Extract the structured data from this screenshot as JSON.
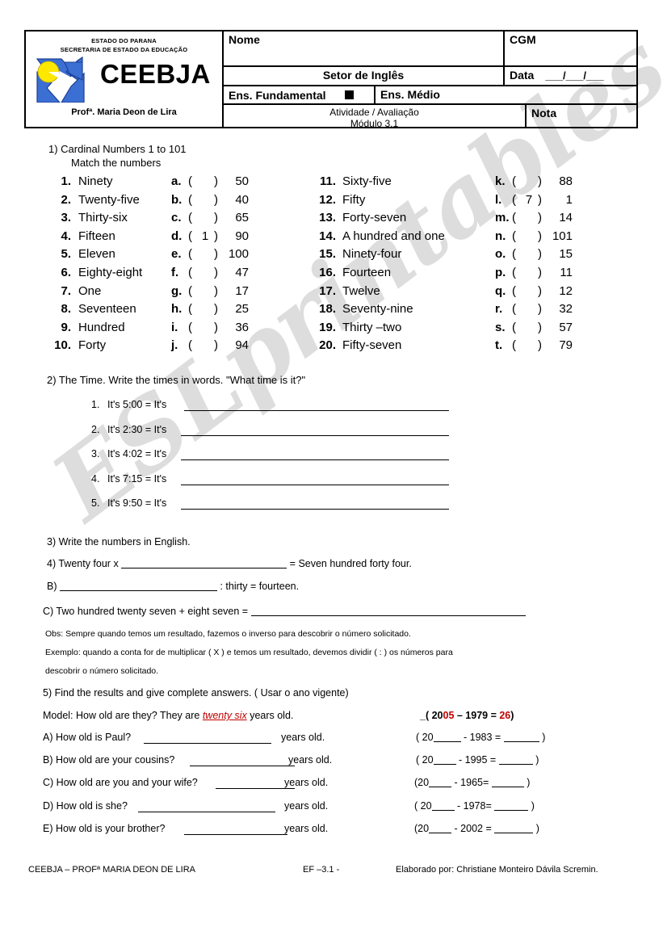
{
  "header": {
    "estado_line1": "ESTADO DO PARANA",
    "estado_line2": "SECRETARIA DE ESTADO DA EDUCAÇÃO",
    "logo_word": "CEEBJA",
    "prof_line": "Profª. Maria Deon de Lira",
    "nome_label": "Nome",
    "cgm_label": "CGM",
    "setor_label": "Setor de Inglês",
    "data_label": "Data",
    "data_blanks": "___/___/___",
    "ens_fundamental_label": "Ens. Fundamental",
    "ens_medio_label": "Ens. Médio",
    "atividade_line1": "Atividade / Avaliação",
    "atividade_line2": "Módulo 3.1",
    "nota_label": "Nota"
  },
  "watermark": {
    "text": "ESLprintables.com"
  },
  "exercise1": {
    "title": "1)  Cardinal Numbers 1 to 101",
    "subtitle": "Match the numbers",
    "left_items": [
      {
        "idx": "1.",
        "word": "Ninety",
        "letter": "a.",
        "answer": "",
        "value": "50"
      },
      {
        "idx": "2.",
        "word": "Twenty-five",
        "letter": "b.",
        "answer": "",
        "value": "40"
      },
      {
        "idx": "3.",
        "word": "Thirty-six",
        "letter": "c.",
        "answer": "",
        "value": "65"
      },
      {
        "idx": "4.",
        "word": "Fifteen",
        "letter": "d.",
        "answer": "1",
        "value": "90"
      },
      {
        "idx": "5.",
        "word": "Eleven",
        "letter": "e.",
        "answer": "",
        "value": "100"
      },
      {
        "idx": "6.",
        "word": "Eighty-eight",
        "letter": "f.",
        "answer": "",
        "value": "47"
      },
      {
        "idx": "7.",
        "word": "One",
        "letter": "g.",
        "answer": "",
        "value": "17"
      },
      {
        "idx": "8.",
        "word": "Seventeen",
        "letter": "h.",
        "answer": "",
        "value": "25"
      },
      {
        "idx": "9.",
        "word": "Hundred",
        "letter": "i.",
        "answer": "",
        "value": "36"
      },
      {
        "idx": "10.",
        "word": "Forty",
        "letter": "j.",
        "answer": "",
        "value": "94"
      }
    ],
    "right_items": [
      {
        "idx": "11.",
        "word": "Sixty-five",
        "letter": "k.",
        "answer": "",
        "value": "88"
      },
      {
        "idx": "12.",
        "word": "Fifty",
        "letter": "l.",
        "answer": "7",
        "value": "1"
      },
      {
        "idx": "13.",
        "word": "Forty-seven",
        "letter": "m.",
        "answer": "",
        "value": "14"
      },
      {
        "idx": "14.",
        "word": "A hundred and one",
        "letter": "n.",
        "answer": "",
        "value": "101"
      },
      {
        "idx": "15.",
        "word": "Ninety-four",
        "letter": "o.",
        "answer": "",
        "value": "15"
      },
      {
        "idx": "16.",
        "word": "Fourteen",
        "letter": "p.",
        "answer": "",
        "value": "11"
      },
      {
        "idx": "17.",
        "word": "Twelve",
        "letter": "q.",
        "answer": "",
        "value": "12"
      },
      {
        "idx": "18.",
        "word": "Seventy-nine",
        "letter": "r.",
        "answer": "",
        "value": "32"
      },
      {
        "idx": "19.",
        "word": "Thirty –two",
        "letter": "s.",
        "answer": "",
        "value": "57"
      },
      {
        "idx": "20.",
        "word": "Fifty-seven",
        "letter": "t.",
        "answer": "",
        "value": "79"
      }
    ]
  },
  "exercise2": {
    "title": "2)  The Time. Write the times in words. \"What time is it?\"",
    "items": [
      {
        "idx": "1.",
        "text": "It's 5:00 = It's"
      },
      {
        "idx": "2.",
        "text": "It's 2:30 = It's"
      },
      {
        "idx": "3.",
        "text": "It's 4:02 = It's"
      },
      {
        "idx": "4.",
        "text": "It's 7:15 = It's"
      },
      {
        "idx": "5.",
        "text": "It's 9:50 = It's"
      }
    ]
  },
  "exercise3": {
    "title": "3)  Write the numbers in English."
  },
  "exercise4": {
    "line_a_prefix": "4)  Twenty four x",
    "line_a_suffix": "= Seven hundred forty four.",
    "line_b_prefix": "B)",
    "line_b_suffix": ": thirty = fourteen.",
    "line_c_prefix": "C) Two hundred twenty seven + eight seven =",
    "obs": "Obs: Sempre quando temos um resultado, fazemos o inverso para descobrir o número solicitado.",
    "exemplo_line1": "Exemplo: quando a conta for de multiplicar  ( X ) e temos um resultado, devemos dividir ( : ) os números para",
    "exemplo_line2": "descobrir o número solicitado."
  },
  "exercise5": {
    "title": "5)  Find the results and give complete answers. ( Usar o ano vigente)",
    "model_prefix": "Model: How old are they? They are",
    "model_answer": "twenty six",
    "model_suffix": "years old.",
    "model_calc_open": "_( 20",
    "model_calc_red1": "05",
    "model_calc_mid": " – 1979 = ",
    "model_calc_red2": "26",
    "model_calc_close": ")",
    "items": [
      {
        "question": "A) How old is Paul?",
        "years": "years old.",
        "calc_open": "( 20",
        "calc_mid": "- 1983 =",
        "calc_close": ")"
      },
      {
        "question": "B) How old are your cousins?",
        "years": "years old.",
        "calc_open": "( 20",
        "calc_mid": "- 1995 =",
        "calc_close": ")"
      },
      {
        "question": "C) How old are you and your wife?",
        "years": "years old.",
        "calc_open": "(20",
        "calc_mid": "- 1965=",
        "calc_close": ")"
      },
      {
        "question": "D) How old is she?",
        "years": "years old.",
        "calc_open": "( 20",
        "calc_mid": "- 1978=",
        "calc_close": ")"
      },
      {
        "question": "E) How old is your brother?",
        "years": "years old.",
        "calc_open": "(20",
        "calc_mid": "- 2002 =",
        "calc_close": ")"
      }
    ]
  },
  "footer": {
    "left": "CEEBJA – PROFª MARIA DEON DE LIRA",
    "center": "EF –3.1 -",
    "right": "Elaborado por: Christiane Monteiro Dávila Scremin."
  },
  "colors": {
    "logo_blue": "#3B6FD4",
    "logo_yellow": "#FFE800",
    "accent_red": "#c00000"
  }
}
